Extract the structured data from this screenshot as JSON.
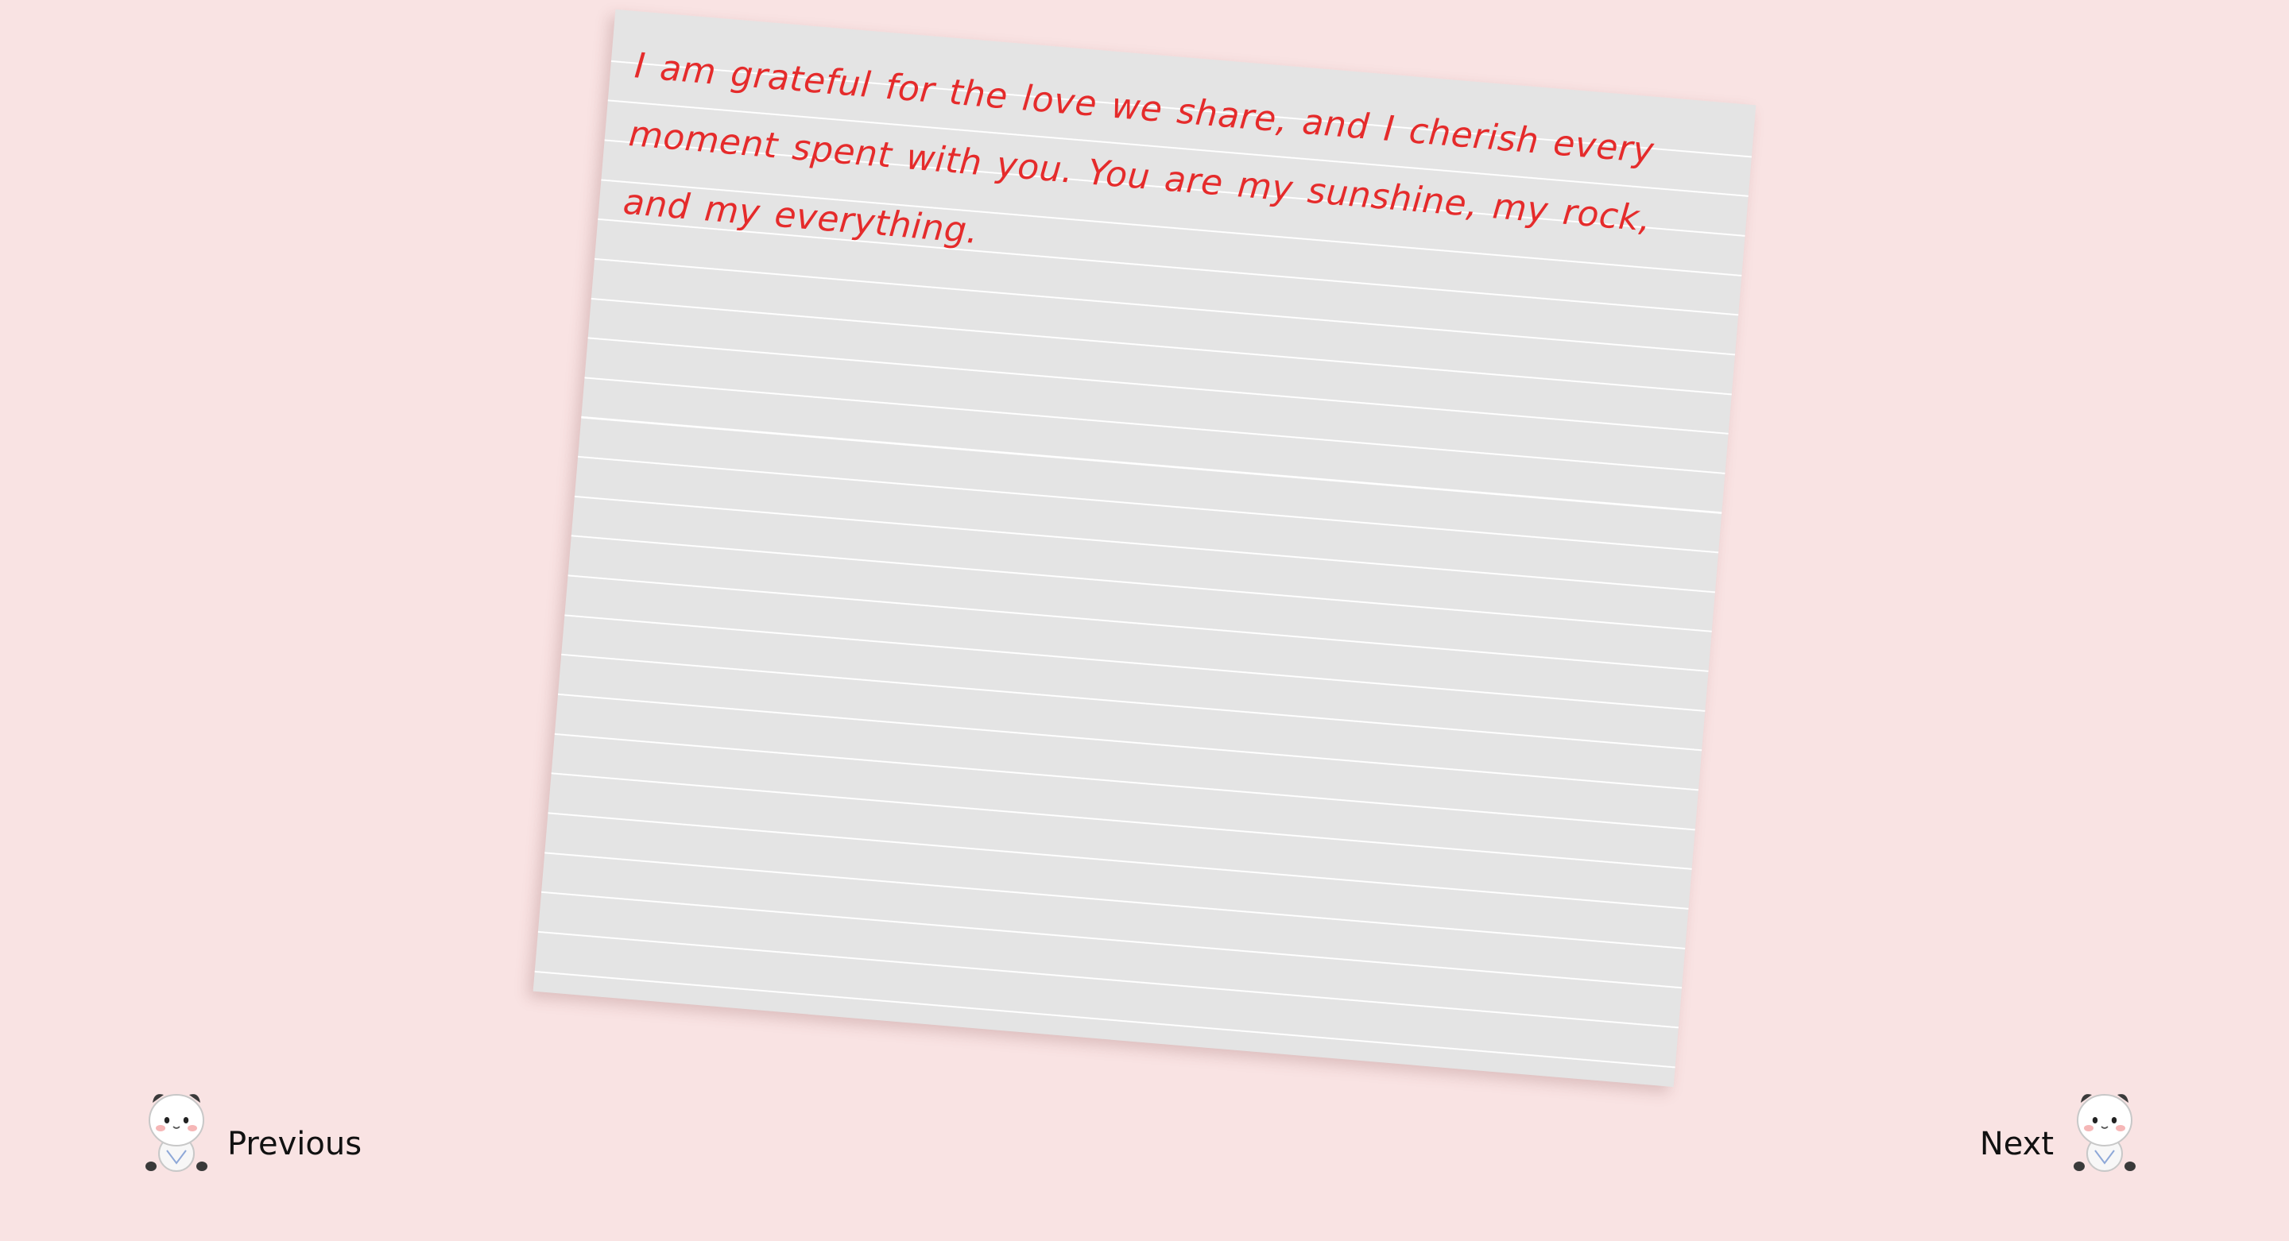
{
  "note": {
    "text": "I am grateful for the love we share, and I cherish every moment spent with you. You are my sunshine, my rock, and my everything."
  },
  "navigation": {
    "previous_label": "Previous",
    "next_label": "Next",
    "previous_icon": "panda-mascot-icon",
    "next_icon": "panda-mascot-icon"
  },
  "colors": {
    "background": "#f9e3e3",
    "paper": "#e4e4e4",
    "paper_lines": "#ffffff",
    "note_text": "#e52b2b"
  }
}
